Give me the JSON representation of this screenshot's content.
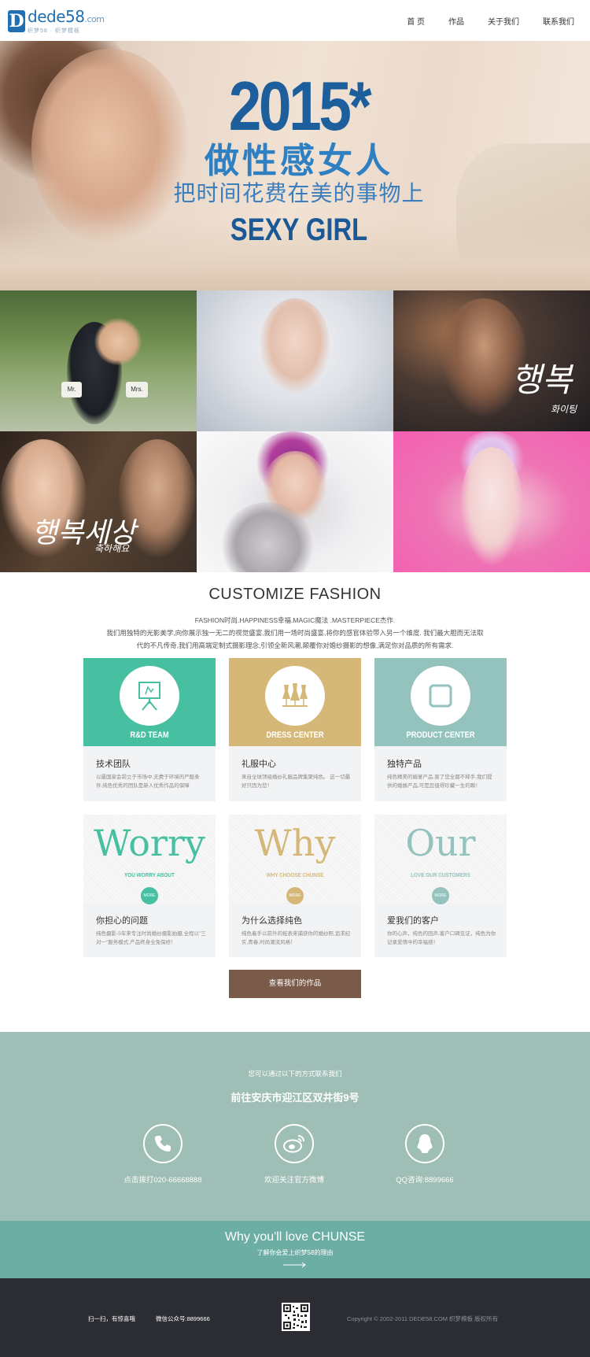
{
  "logo": {
    "badge": "D",
    "main": "dede58",
    "suffix": ".com",
    "sub": "织梦58 · 织梦模板"
  },
  "nav": {
    "items": [
      "首 页",
      "作品",
      "关于我们",
      "联系我们"
    ]
  },
  "hero": {
    "year": "2015*",
    "line1": "做性感女人",
    "line2": "把时间花费在美的事物上",
    "line3": "SEXY GIRL"
  },
  "gallery": {
    "sign1_a": "Mr.",
    "sign1_b": "Mrs.",
    "script3": "행복",
    "script3_small": "화이팅",
    "script4": "행복세상",
    "script4_small": "축하해요"
  },
  "intro": {
    "title": "CUSTOMIZE FASHION",
    "line1": "FASHION时尚.HAPPINESS幸福.MAGIC魔法 .MASTERPIECE杰作.",
    "line2": "我们用独特的光影美学,向你展示独一无二的视觉盛宴,我们用一场时尚盛宴,将你的感官体验带入另一个维度. 我们最大胆而无法取",
    "line3": "代的不凡传奇,我们用高端定制式摄影理念,引领全新风潮,颠覆你对婚纱摄影的想像,满足你对品质的所有需求."
  },
  "services": [
    {
      "label": "R&D TEAM",
      "title": "技术团队",
      "text": "以最国家会前立于市场中,无费于环境的严酷条件,纯色优秀的团队是新人优秀作品的保障",
      "color": "#47bfa1",
      "icon": "easel-icon"
    },
    {
      "label": "DRESS CENTER",
      "title": "礼服中心",
      "text": "来自全球顶级婚纱礼服品牌集聚纯色。 这一切最好只因为您！",
      "color": "#d5b878",
      "icon": "dress-icon"
    },
    {
      "label": "PRODUCT CENTER",
      "title": "独特产品",
      "text": "纯色精美的婚宴产品,害了您全都不释手,我们提供的婚嫁产品,可是您值得珍藏一生的瞬！",
      "color": "#94c3be",
      "icon": "square-icon"
    }
  ],
  "features": [
    {
      "word": "Worry",
      "sub": "YOU WORRY ABOUT",
      "more": "MORE",
      "title": "你担心的问题",
      "text": "纯色摄影-5年来专注时尚婚纱摄影拍摄,全程以\"三对一\"服务模式,产品终身全免保修！",
      "color": "#47bfa1"
    },
    {
      "word": "Why",
      "sub": "WHY CHOOSE CHUNSE",
      "more": "MORE",
      "title": "为什么选择纯色",
      "text": "纯色着手以前外的拓表来捕获你的婚纱照,追求纪实,青春,时尚潮流风格！",
      "color": "#d5b878"
    },
    {
      "word": "Our",
      "sub": "LOVE OUR CUSTOMERS",
      "more": "MORE",
      "title": "爱我们的客户",
      "text": "你的心声，纯色的回声,客户口碑见证，纯色为你记录爱情中的幸福感！",
      "color": "#94c3be"
    }
  ],
  "cta": {
    "label": "查看我们的作品"
  },
  "contact": {
    "small": "您可以通过以下的方式联系我们",
    "address": "前往安庆市迎江区双井街9号",
    "items": [
      {
        "label": "点击拨打020-66668888",
        "icon": "phone-icon"
      },
      {
        "label": "欢迎关注官方微博",
        "icon": "weibo-icon"
      },
      {
        "label": "QQ咨询:8899666",
        "icon": "qq-icon"
      }
    ]
  },
  "love": {
    "title": "Why you'll love CHUNSE",
    "sub": "了解你会爱上织梦58的理由"
  },
  "footer": {
    "scan": "扫一扫，有惊喜哦",
    "wechat": "微信公众号:8899666",
    "copyright": "Copyright © 2002-2011 DEDE58.COM 织梦模板 版权所有"
  }
}
